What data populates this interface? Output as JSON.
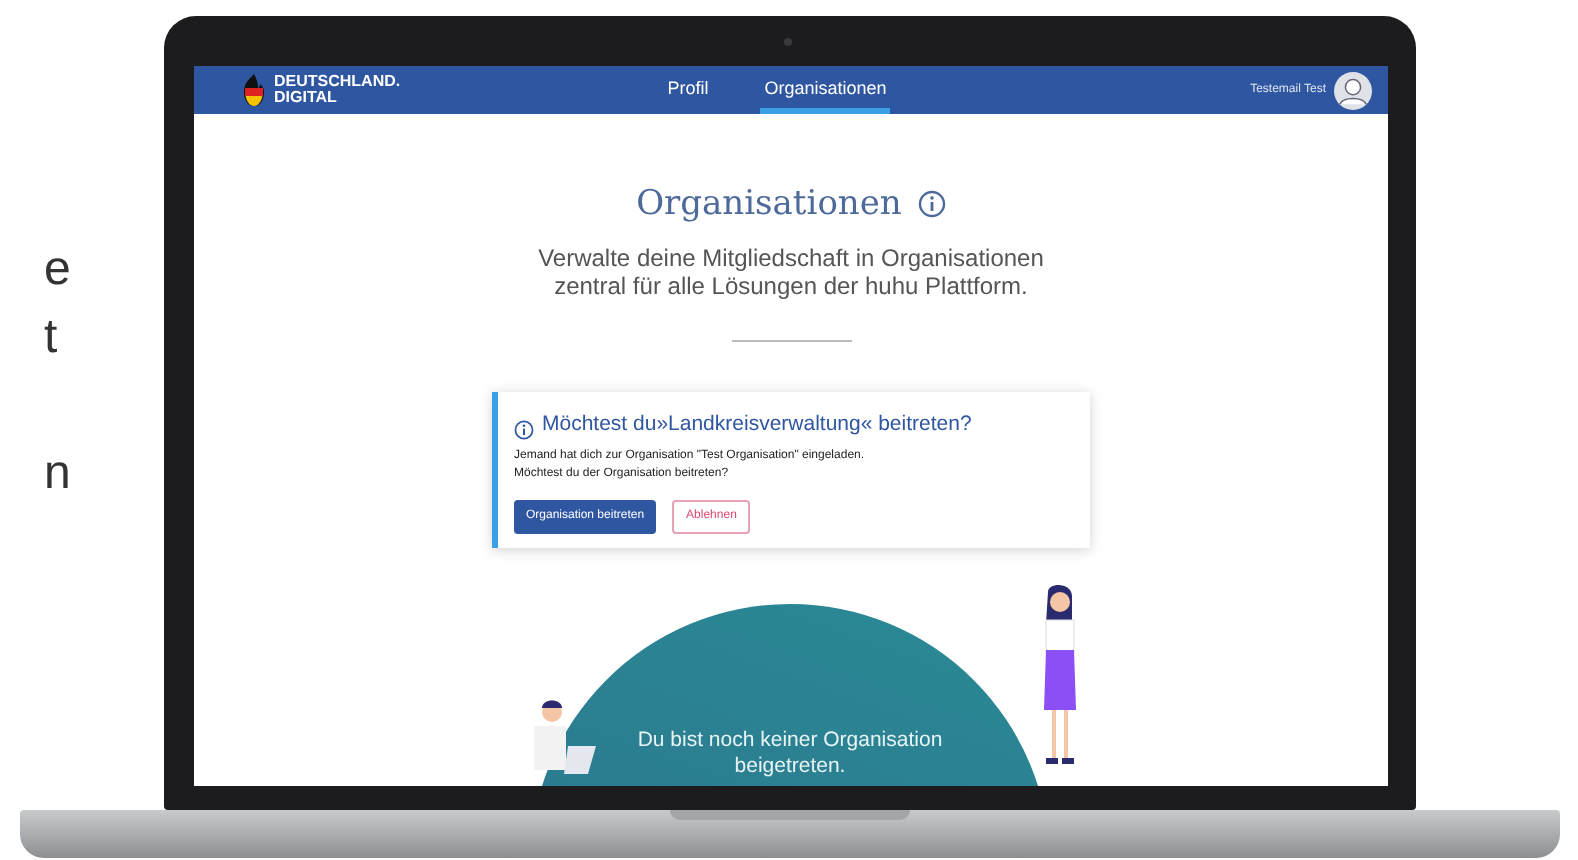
{
  "side_text": [
    "e",
    "t",
    "n"
  ],
  "navbar": {
    "logo_lines": [
      "DEUTSCHLAND.",
      "DIGITAL"
    ],
    "links": [
      {
        "label": "Profil",
        "selected": false
      },
      {
        "label": "Organisationen",
        "selected": true
      }
    ],
    "user_name": "Testemail Test"
  },
  "header": {
    "title": "Organisationen",
    "subtitle_lines": [
      "Verwalte deine Mitgliedschaft in Organisationen",
      "zentral für alle Lösungen der huhu Plattform."
    ]
  },
  "invitation": {
    "title": "Möchtest du»Landkreisverwaltung« beitreten?",
    "text_lines": [
      "Jemand hat dich zur Organisation \"Test Organisation\" eingeladen.",
      "Möchtest du der Organisation beitreten?"
    ],
    "buttons": [
      {
        "label": "Organisation beitreten",
        "kind": "primary"
      },
      {
        "label": "Ablehnen",
        "kind": "outline"
      }
    ]
  },
  "empty_state": {
    "message_lines": [
      "Du bist noch keiner Organisation",
      "beigetreten."
    ]
  }
}
